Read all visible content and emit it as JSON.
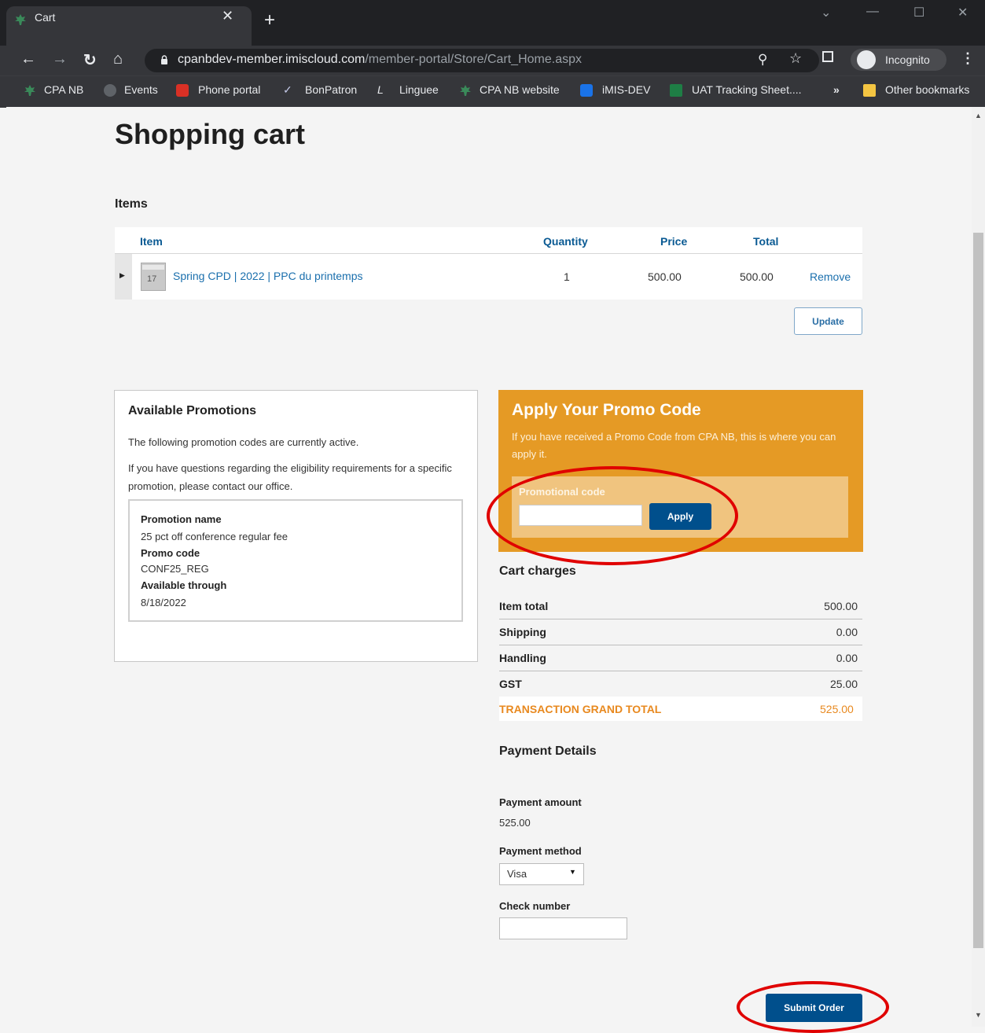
{
  "browser": {
    "tab_title": "Cart",
    "url_host": "cpanbdev-member.imiscloud.com",
    "url_path": "/member-portal/Store/Cart_Home.aspx",
    "profile_label": "Incognito",
    "bookmarks": [
      "CPA NB",
      "Events",
      "Phone portal",
      "BonPatron",
      "Linguee",
      "CPA NB website",
      "iMIS-DEV",
      "UAT Tracking Sheet....",
      "Other bookmarks"
    ]
  },
  "page": {
    "title": "Shopping cart",
    "items_heading": "Items",
    "table": {
      "headers": {
        "item": "Item",
        "quantity": "Quantity",
        "price": "Price",
        "total": "Total"
      },
      "row": {
        "name": "Spring CPD | 2022 | PPC du printemps",
        "quantity": "1",
        "price": "500.00",
        "total": "500.00",
        "remove": "Remove",
        "cal_day": "17"
      }
    },
    "update_label": "Update",
    "promotions": {
      "heading": "Available Promotions",
      "intro1": "The following promotion codes are currently active.",
      "intro2": "If you have questions regarding the eligibility requirements for a specific promotion, please contact our office.",
      "name_label": "Promotion name",
      "name_value": "25 pct off conference regular fee",
      "code_label": "Promo code",
      "code_value": "CONF25_REG",
      "through_label": "Available through",
      "through_value": "8/18/2022"
    },
    "promo_box": {
      "heading": "Apply Your Promo Code",
      "desc": "If you have received a Promo Code from CPA NB, this is where you can apply it.",
      "field_label": "Promotional code",
      "field_value": "",
      "apply_label": "Apply"
    },
    "charges": {
      "heading": "Cart charges",
      "rows": [
        {
          "label": "Item total",
          "value": "500.00"
        },
        {
          "label": "Shipping",
          "value": "0.00"
        },
        {
          "label": "Handling",
          "value": "0.00"
        },
        {
          "label": "GST",
          "value": "25.00"
        }
      ],
      "grand_label": "TRANSACTION GRAND TOTAL",
      "grand_value": "525.00"
    },
    "payment": {
      "heading": "Payment Details",
      "amount_label": "Payment amount",
      "amount_value": "525.00",
      "method_label": "Payment method",
      "method_value": "Visa",
      "check_label": "Check number",
      "check_value": ""
    },
    "submit_label": "Submit Order"
  },
  "colors": {
    "promo_bg": "#e59a25",
    "promo_inner": "#f0c47f",
    "accent_orange": "#e8891f",
    "primary_blue": "#004f8c",
    "annotation_red": "#e00000"
  }
}
